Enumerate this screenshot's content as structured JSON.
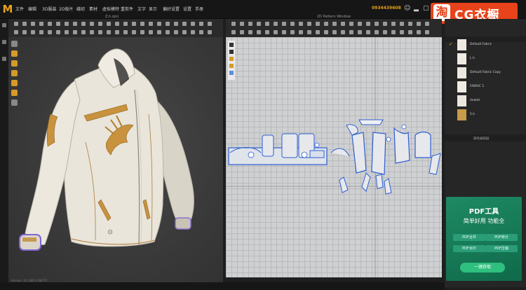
{
  "app": {
    "logo": "M"
  },
  "menu": {
    "items": [
      "文件",
      "编辑",
      "3D服装",
      "2D板片",
      "缝纫",
      "素材",
      "虚拟模特",
      "重剪件",
      "文字",
      "显示",
      "偏好设置",
      "设置",
      "手册"
    ]
  },
  "header": {
    "phone": "0934439608"
  },
  "watermark": {
    "glyph": "淘",
    "text": "CG衣橱"
  },
  "tabs": {
    "viewport_3d": "Z.h.zprj",
    "viewport_2d": "2D Pattern Window"
  },
  "fabric_panel": {
    "items": [
      {
        "name": "Default Fabric",
        "color": "#eeeae2",
        "selected": true
      },
      {
        "name": "L.h",
        "color": "#efebe3",
        "selected": false
      },
      {
        "name": "Default Fabric Copy",
        "color": "#ece8df",
        "selected": false
      },
      {
        "name": "FABRIC 1",
        "color": "#efebe3",
        "selected": false
      },
      {
        "name": "dealet",
        "color": "#ebe7de",
        "selected": false
      },
      {
        "name": "5.h",
        "color": "#c89a4a",
        "selected": false
      }
    ],
    "property_title": "属性编辑器"
  },
  "status": {
    "text": "Version: 4.0.180 (r33077)"
  },
  "ad": {
    "title": "PDF工具",
    "subtitle": "简单好用 功能全",
    "chips": [
      "PDF合并",
      "PDF转分",
      "PDF水印",
      "PDF压缩"
    ],
    "button": "一键获取",
    "accent": "#2fbf7e"
  },
  "colors": {
    "accent": "#e8a21b",
    "brand": "#e8431a"
  }
}
